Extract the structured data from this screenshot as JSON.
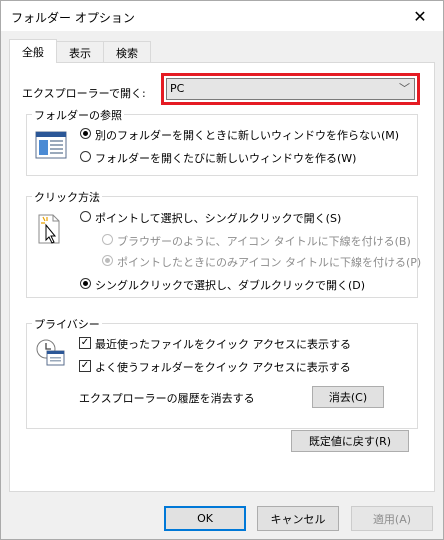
{
  "window": {
    "title": "フォルダー オプション"
  },
  "tabs": [
    {
      "label": "全般"
    },
    {
      "label": "表示"
    },
    {
      "label": "検索"
    }
  ],
  "general": {
    "open_label": "エクスプローラーで開く:",
    "open_value": "PC"
  },
  "browse": {
    "title": "フォルダーの参照",
    "option1": "別のフォルダーを開くときに新しいウィンドウを作らない(M)",
    "option2": "フォルダーを開くたびに新しいウィンドウを作る(W)",
    "selected": "option1"
  },
  "click": {
    "title": "クリック方法",
    "option1": "ポイントして選択し、シングルクリックで開く(S)",
    "sub1": "ブラウザーのように、アイコン タイトルに下線を付ける(B)",
    "sub2": "ポイントしたときにのみアイコン タイトルに下線を付ける(P)",
    "option2": "シングルクリックで選択し、ダブルクリックで開く(D)"
  },
  "privacy": {
    "title": "プライバシー",
    "check1": "最近使ったファイルをクイック アクセスに表示する",
    "check2": "よく使うフォルダーをクイック アクセスに表示する",
    "history_label": "エクスプローラーの履歴を消去する",
    "clear_button": "消去(C)"
  },
  "restore_button": "既定値に戻す(R)",
  "footer": {
    "ok": "OK",
    "cancel": "キャンセル",
    "apply": "適用(A)"
  },
  "colors": {
    "highlight_border": "#e51b23",
    "primary_border": "#0078d7"
  }
}
